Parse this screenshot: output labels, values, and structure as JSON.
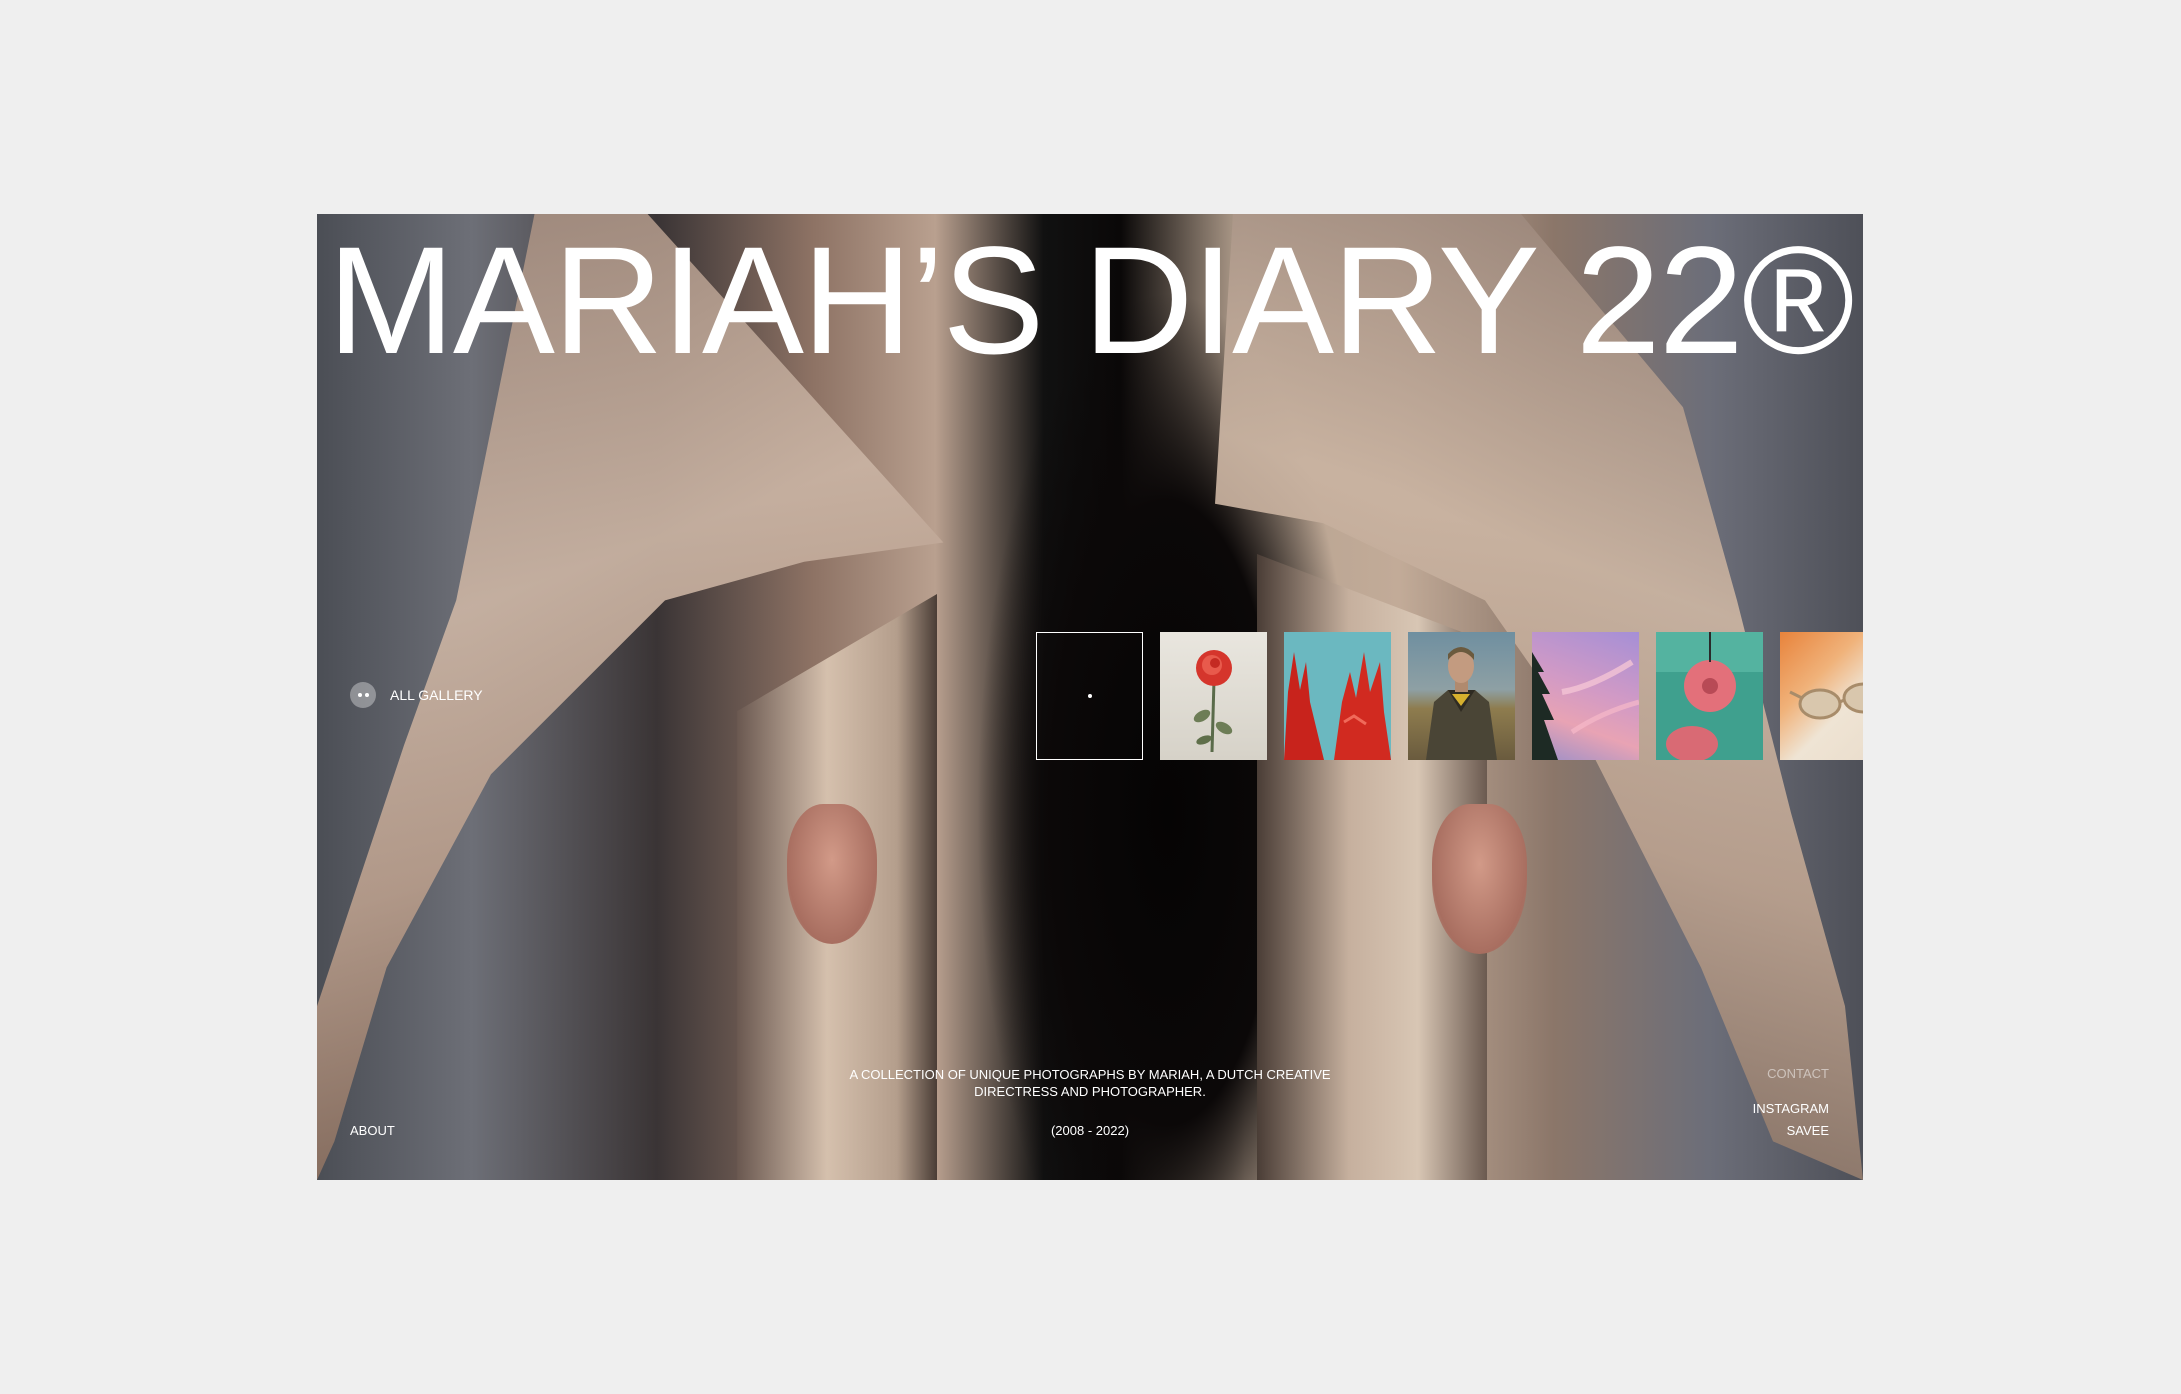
{
  "header": {
    "title": "MARIAH’S DIARY 22®"
  },
  "gallery": {
    "toggle_label": "ALL GALLERY",
    "toggle_icon": "two-dots-icon",
    "thumbnails": [
      {
        "name": "active-frame",
        "icon": "dot-icon"
      },
      {
        "name": "red-rose"
      },
      {
        "name": "red-gloves"
      },
      {
        "name": "man-in-coat"
      },
      {
        "name": "pink-sky-tree"
      },
      {
        "name": "pink-donut"
      },
      {
        "name": "sunglasses"
      }
    ]
  },
  "footer": {
    "about_label": "ABOUT",
    "description": "A COLLECTION OF UNIQUE PHOTOGRAPHS BY MARIAH, A DUTCH CREATIVE DIRECTRESS AND PHOTOGRAPHER.",
    "years": "(2008 - 2022)",
    "contact_label": "CONTACT",
    "links": [
      "INSTAGRAM",
      "SAVEE"
    ]
  },
  "colors": {
    "page_background": "#efefef",
    "text": "#ffffff",
    "coat": "#c2ab98"
  }
}
